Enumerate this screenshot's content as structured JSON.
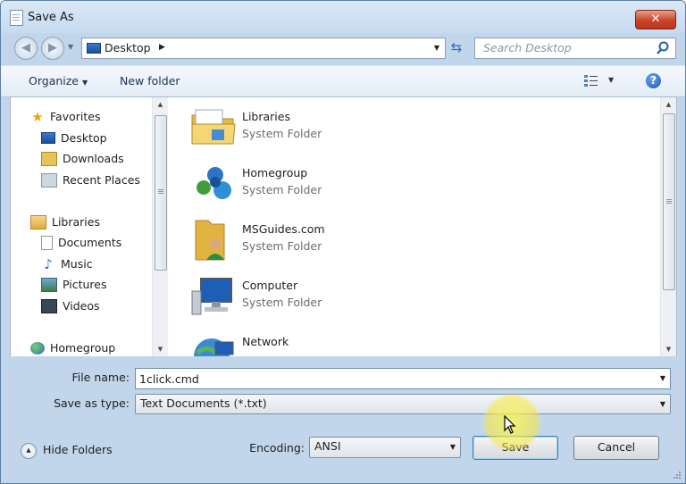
{
  "window": {
    "title": "Save As",
    "close_glyph": "✕"
  },
  "nav": {
    "back_glyph": "◀",
    "forward_glyph": "▶",
    "address": {
      "location": "Desktop",
      "separator": "▶"
    },
    "refresh_glyph": "⇆",
    "search": {
      "placeholder": "Search Desktop"
    }
  },
  "toolbar": {
    "organize_label": "Organize",
    "new_folder_label": "New folder",
    "help_glyph": "?"
  },
  "sidebar": {
    "items": [
      {
        "label": "Favorites",
        "icon": "star-icon"
      },
      {
        "label": "Desktop",
        "icon": "desktop-icon"
      },
      {
        "label": "Downloads",
        "icon": "downloads-icon"
      },
      {
        "label": "Recent Places",
        "icon": "recent-places-icon"
      },
      {
        "label": "Libraries",
        "icon": "libraries-icon"
      },
      {
        "label": "Documents",
        "icon": "documents-icon"
      },
      {
        "label": "Music",
        "icon": "music-icon"
      },
      {
        "label": "Pictures",
        "icon": "pictures-icon"
      },
      {
        "label": "Videos",
        "icon": "videos-icon"
      },
      {
        "label": "Homegroup",
        "icon": "homegroup-icon"
      }
    ]
  },
  "files": [
    {
      "name": "Libraries",
      "type": "System Folder",
      "icon": "libraries-folder-icon"
    },
    {
      "name": "Homegroup",
      "type": "System Folder",
      "icon": "homegroup-icon"
    },
    {
      "name": "MSGuides.com",
      "type": "System Folder",
      "icon": "user-folder-icon"
    },
    {
      "name": "Computer",
      "type": "System Folder",
      "icon": "computer-icon"
    },
    {
      "name": "Network",
      "type": "",
      "icon": "network-icon"
    }
  ],
  "form": {
    "file_name_label": "File name:",
    "file_name_value": "1click.cmd",
    "save_as_type_label": "Save as type:",
    "save_as_type_value": "Text Documents (*.txt)",
    "encoding_label": "Encoding:",
    "encoding_value": "ANSI"
  },
  "buttons": {
    "hide_folders": "Hide Folders",
    "save": "Save",
    "cancel": "Cancel"
  },
  "colors": {
    "accent": "#3c7fb1",
    "frame": "#c2d6eb",
    "highlight": "#f8e83c"
  }
}
